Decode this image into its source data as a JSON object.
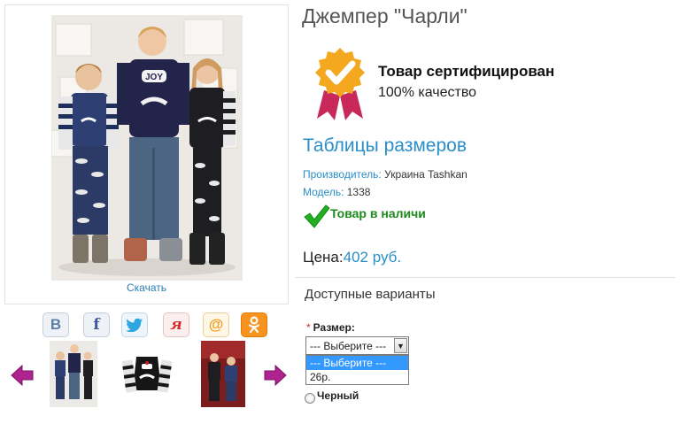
{
  "product": {
    "title": "Джемпер \"Чарли\"",
    "download_label": "Скачать",
    "certificate": {
      "title": "Товар сертифицирован",
      "subtitle": "100% качество"
    },
    "size_tables_link": "Таблицы размеров",
    "manufacturer_key": "Производитель:",
    "manufacturer_value": "Украина Tashkan",
    "model_key": "Модель:",
    "model_value": "1338",
    "stock_status": "Товар в наличи",
    "price_label": "Цена:",
    "price_value": "402 руб.",
    "variants_heading": "Доступные варианты",
    "size_required_mark": "*",
    "size_label": "Размер:",
    "size_select": {
      "selected": "--- Выберите ---",
      "options": [
        "--- Выберите ---",
        "26р."
      ]
    },
    "color_option": "Черный"
  },
  "share": {
    "icons": [
      "vk-icon",
      "facebook-icon",
      "twitter-icon",
      "yaru-icon",
      "mailru-icon",
      "odnoklassniki-icon"
    ]
  },
  "colors": {
    "link": "#2a8ec8",
    "stock_green": "#1a8a1a",
    "badge_gold": "#f3a81f",
    "ribbon": "#c8285a",
    "selection": "#3399ff",
    "arrow": "#b0238f"
  }
}
